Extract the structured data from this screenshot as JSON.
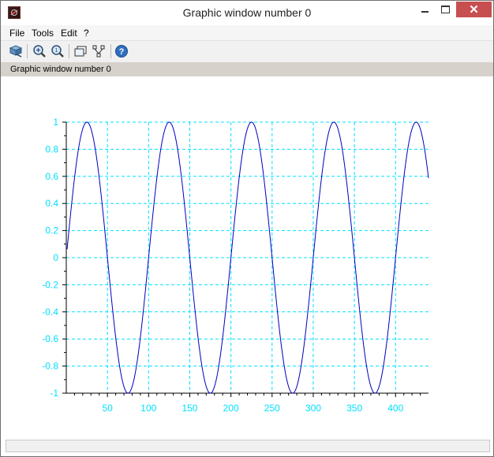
{
  "window": {
    "title": "Graphic window number 0"
  },
  "menu": {
    "items": [
      "File",
      "Tools",
      "Edit",
      "?"
    ]
  },
  "toolbar": {
    "icons": [
      "rotate-icon",
      "zoom-in-icon",
      "zoom-reset-icon",
      "datatip-icon",
      "edit-axes-icon",
      "help-icon"
    ]
  },
  "infobar": {
    "text": "Graphic window number 0"
  },
  "chart_data": {
    "type": "line",
    "xlim": [
      0,
      440
    ],
    "ylim": [
      -1,
      1
    ],
    "x_ticks": [
      50,
      100,
      150,
      200,
      250,
      300,
      350,
      400
    ],
    "y_ticks": [
      1,
      0.8,
      0.6,
      0.4,
      0.2,
      0,
      -0.2,
      -0.4,
      -0.6,
      -0.8,
      -1
    ],
    "y_tick_labels": [
      "1",
      "0.8",
      "0.6",
      "0.4",
      "0.2",
      "0",
      "-0.2",
      "-0.4",
      "-0.6",
      "-0.8",
      "-1"
    ],
    "grid": true,
    "series": [
      {
        "function": "sin(2*pi*x/100)",
        "x_start": 1,
        "x_end": 440,
        "color": "#0000c0"
      }
    ],
    "axis_color": "#000000",
    "grid_color": "#00e0ff",
    "tick_label_color": "#00e0ff"
  }
}
